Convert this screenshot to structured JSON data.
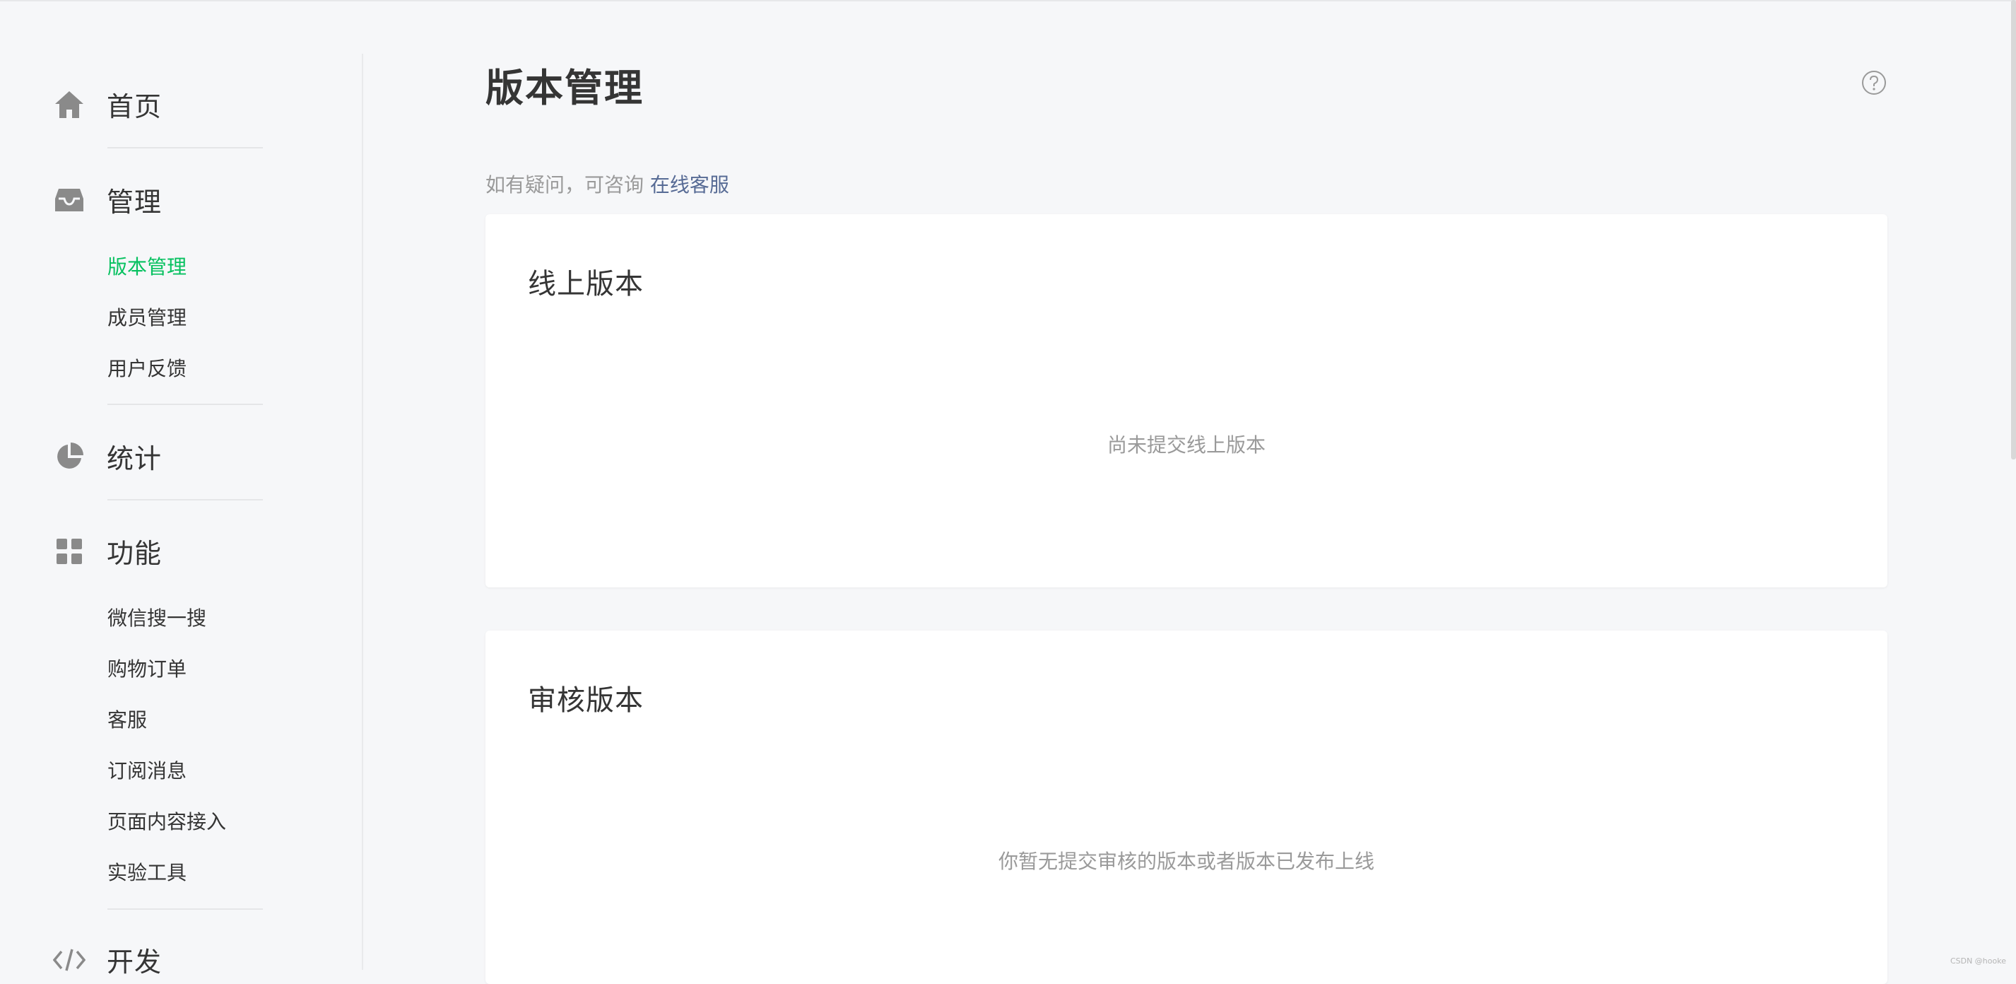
{
  "sidebar": {
    "home": {
      "label": "首页",
      "icon": "home-icon"
    },
    "manage": {
      "label": "管理",
      "icon": "inbox-icon",
      "items": [
        {
          "label": "版本管理",
          "active": true
        },
        {
          "label": "成员管理",
          "active": false
        },
        {
          "label": "用户反馈",
          "active": false
        }
      ]
    },
    "stats": {
      "label": "统计",
      "icon": "pie-chart-icon"
    },
    "features": {
      "label": "功能",
      "icon": "grid-icon",
      "items": [
        {
          "label": "微信搜一搜"
        },
        {
          "label": "购物订单"
        },
        {
          "label": "客服"
        },
        {
          "label": "订阅消息"
        },
        {
          "label": "页面内容接入"
        },
        {
          "label": "实验工具"
        }
      ]
    },
    "develop": {
      "label": "开发",
      "icon": "code-icon"
    }
  },
  "main": {
    "title": "版本管理",
    "help_icon": "help-circle-icon",
    "notice": {
      "text": "如有疑问，可咨询 ",
      "link": "在线客服"
    },
    "online_card": {
      "title": "线上版本",
      "empty": "尚未提交线上版本"
    },
    "review_card": {
      "title": "审核版本",
      "empty": "你暂无提交审核的版本或者版本已发布上线"
    }
  },
  "watermark": "CSDN @hooke",
  "colors": {
    "accent": "#07c160",
    "link": "#576b95",
    "muted": "#9a9a9a",
    "icon": "#8a8a8a"
  }
}
